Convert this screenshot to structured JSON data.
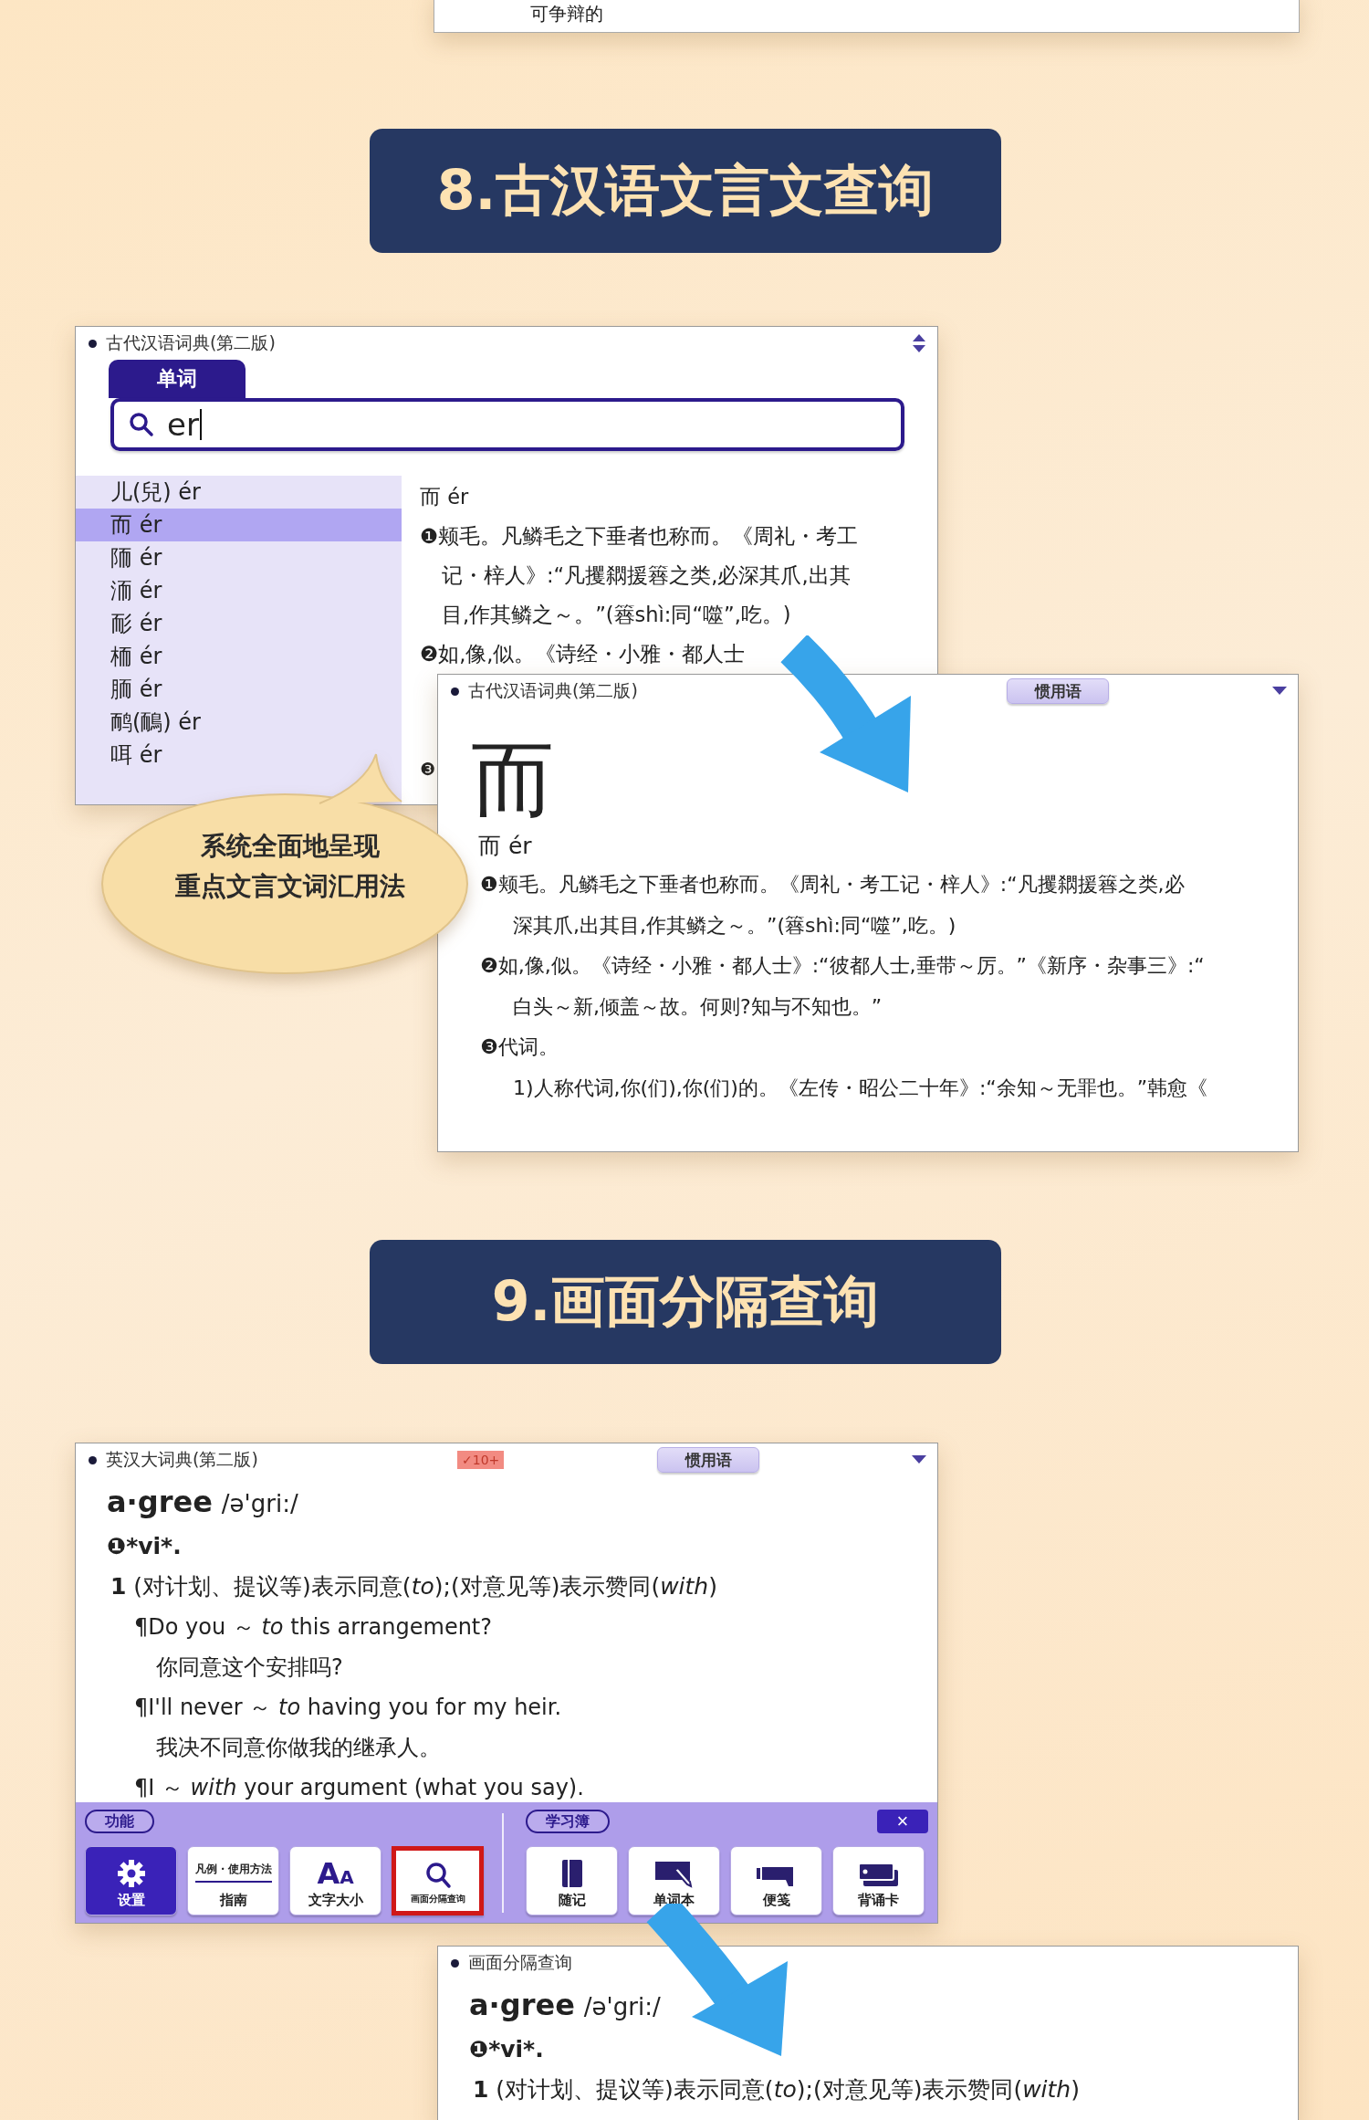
{
  "previous_panel_text": "可争辩的",
  "heading_1": "8.古汉语文言文查询",
  "search_window": {
    "title": "古代汉语词典(第二版)",
    "tab": {
      "label": "单词",
      "selected": true
    },
    "search": {
      "value": "er"
    },
    "results": [
      {
        "label": "儿(兒) ér",
        "selected": false
      },
      {
        "label": "而 ér",
        "selected": true
      },
      {
        "label": "陑 ér",
        "selected": false
      },
      {
        "label": "洏 ér",
        "selected": false
      },
      {
        "label": "耏 ér",
        "selected": false
      },
      {
        "label": "栭 ér",
        "selected": false
      },
      {
        "label": "胹 ér",
        "selected": false
      },
      {
        "label": "鸸(鴯) ér",
        "selected": false
      },
      {
        "label": "咡 ér",
        "selected": false
      }
    ],
    "entry_lines": [
      {
        "text": "而 ér",
        "indent": false
      },
      {
        "text": "❶颊毛。凡鳞毛之下垂者也称而。《周礼・考工",
        "indent": false
      },
      {
        "text": "记・梓人》:“凡攫閷援簭之类,必深其爪,出其",
        "indent": true
      },
      {
        "text": "目,作其鳞之～。”(簭shì:同“噬”,吃。)",
        "indent": true
      },
      {
        "text": "❷如,像,似。《诗经・小雅・都人士",
        "indent": false
      },
      {
        "text": "❸",
        "indent": false
      }
    ]
  },
  "callout": {
    "lines": [
      "系统全面地呈现",
      "重点文言文词汇用法"
    ]
  },
  "entry_window": {
    "title": "古代汉语词典(第二版)",
    "idiom_button": "惯用语",
    "headword": "而",
    "reading": "而 ér",
    "lines": [
      {
        "text": "❶颊毛。凡鳞毛之下垂者也称而。《周礼・考工记・梓人》:“凡攫閷援簭之类,必",
        "indent": false
      },
      {
        "text": "深其爪,出其目,作其鳞之～。”(簭shì:同“噬”,吃。)",
        "indent": true
      },
      {
        "text": "❷如,像,似。《诗经・小雅・都人士》:“彼都人士,垂带～厉。”《新序・杂事三》:“",
        "indent": false
      },
      {
        "text": "白头～新,倾盖～故。何则?知与不知也。”",
        "indent": true
      },
      {
        "text": "❸代词。",
        "indent": false
      },
      {
        "text": "1)人称代词,你(们),你(们)的。《左传・昭公二十年》:“余知～无罪也。”韩愈《",
        "indent": true
      }
    ]
  },
  "heading_2": "9.画面分隔查询",
  "english_window": {
    "title": "英汉大词典(第二版)",
    "badge": "✓10+",
    "idiom_button": "惯用语",
    "headword": "a·gree",
    "pronunciation": "/ə'gri:/",
    "lines": [
      {
        "kind": "pos",
        "text": "❶*vi*."
      },
      {
        "kind": "definition",
        "text": "**1** (对计划、提议等)表示同意(*to*);(对意见等)表示赞同(*with*)"
      },
      {
        "kind": "example",
        "text": "¶Do you ～ *to* this arrangement?"
      },
      {
        "kind": "translation",
        "text": "你同意这个安排吗?"
      },
      {
        "kind": "example",
        "text": "¶I'll never ～ *to* having you for my heir."
      },
      {
        "kind": "translation",
        "text": "我决不同意你做我的继承人。"
      },
      {
        "kind": "example",
        "text": "¶I ～ *with* your argument (what you say)."
      }
    ],
    "toolbar": {
      "function_label": "功能",
      "study_label": "学习簿",
      "close": "×",
      "function_buttons": [
        {
          "label": "设置",
          "kind": "gear",
          "selected": true,
          "highlighted": false
        },
        {
          "label": "指南",
          "kind": "caption",
          "caption": "凡例・使用方法",
          "selected": false,
          "highlighted": false
        },
        {
          "label": "文字大小",
          "kind": "text-size",
          "icon_text": "AA",
          "selected": false,
          "highlighted": false
        },
        {
          "label": "画面分隔查询",
          "kind": "search",
          "selected": false,
          "highlighted": true
        }
      ],
      "study_buttons": [
        {
          "label": "随记",
          "kind": "notebook",
          "selected": false
        },
        {
          "label": "单词本",
          "kind": "card-pen",
          "selected": false
        },
        {
          "label": "便笺",
          "kind": "marker",
          "selected": false
        },
        {
          "label": "背诵卡",
          "kind": "cards",
          "selected": false
        }
      ]
    }
  },
  "split_window": {
    "title": "画面分隔查询",
    "headword": "a·gree",
    "pronunciation": "/ə'gri:/",
    "lines": [
      {
        "kind": "pos",
        "text": "❶*vi*."
      },
      {
        "kind": "definition",
        "text": "**1** (对计划、提议等)表示同意(*to*);(对意见等)表示赞同(*with*)"
      }
    ]
  }
}
